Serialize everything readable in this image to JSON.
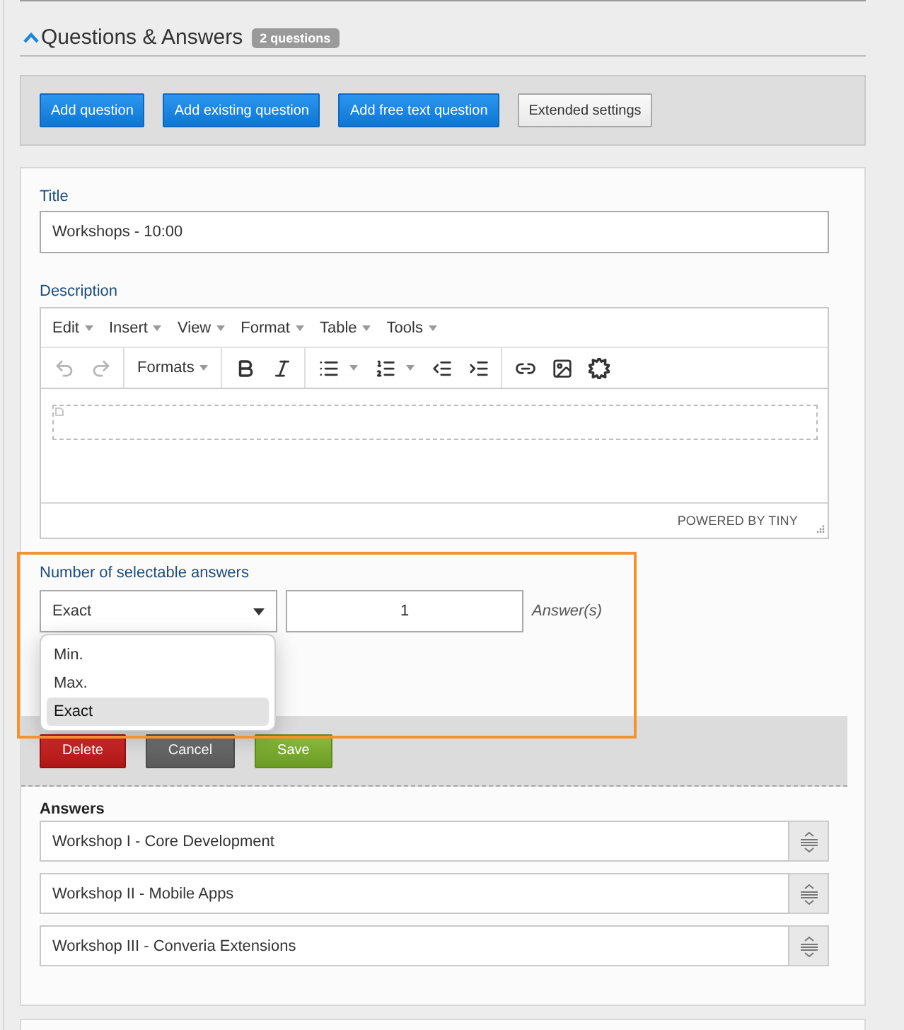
{
  "section": {
    "title": "Questions & Answers",
    "expanded": true,
    "badge": "2 questions"
  },
  "toolbar": [
    {
      "label": "Add question",
      "kind": "primary"
    },
    {
      "label": "Add existing question",
      "kind": "primary"
    },
    {
      "label": "Add free text question",
      "kind": "primary"
    },
    {
      "label": "Extended settings",
      "kind": "secondary"
    }
  ],
  "question": {
    "title_field": {
      "label": "Title",
      "value": "Workshops - 10:00"
    },
    "description": {
      "label": "Description",
      "menus": [
        "Edit",
        "Insert",
        "View",
        "Format",
        "Table",
        "Tools"
      ],
      "tool_groups": [
        [
          {
            "kind": "undo",
            "disabled": true
          },
          {
            "kind": "redo",
            "disabled": true
          }
        ],
        [
          {
            "kind": "dropdown",
            "label": "Formats",
            "disabled": false
          }
        ],
        [
          {
            "kind": "bold",
            "disabled": false
          },
          {
            "kind": "italic",
            "disabled": false
          }
        ],
        [
          {
            "kind": "bullet-list",
            "disabled": false
          },
          {
            "kind": "numbered-list",
            "disabled": false
          },
          {
            "kind": "outdent",
            "disabled": false
          },
          {
            "kind": "indent",
            "disabled": false
          }
        ],
        [
          {
            "kind": "link",
            "disabled": false
          },
          {
            "kind": "image",
            "disabled": false
          },
          {
            "kind": "burst",
            "disabled": false
          }
        ]
      ],
      "branding": "POWERED BY TINY"
    },
    "selectable": {
      "label": "Number of selectable answers",
      "highlighted": true,
      "mode": {
        "value": "Exact",
        "expanded": true,
        "options": [
          {
            "label": "Min.",
            "selected": false
          },
          {
            "label": "Max.",
            "selected": false
          },
          {
            "label": "Exact",
            "selected": true
          }
        ]
      },
      "count": "1",
      "unit": "Answer(s)"
    },
    "actions": [
      {
        "label": "Delete",
        "kind": "danger"
      },
      {
        "label": "Cancel",
        "kind": "neutral"
      },
      {
        "label": "Save",
        "kind": "success"
      }
    ],
    "answers": {
      "label": "Answers",
      "items": [
        "Workshop I - Core Development",
        "Workshop II - Mobile Apps",
        "Workshop III - Converia Extensions"
      ]
    }
  }
}
